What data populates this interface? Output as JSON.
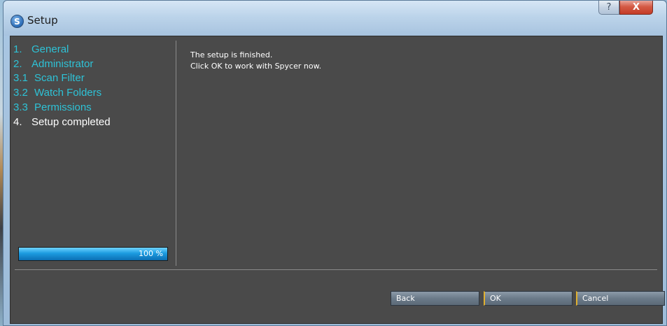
{
  "window": {
    "title": "Setup",
    "app_icon_glyph": "S",
    "help_glyph": "?",
    "close_glyph": "X"
  },
  "nav": {
    "items": [
      {
        "num": "1.",
        "label": "General",
        "state": "done"
      },
      {
        "num": "2.",
        "label": "Administrator",
        "state": "done"
      },
      {
        "num": "3.1",
        "label": "Scan Filter",
        "state": "done"
      },
      {
        "num": "3.2",
        "label": "Watch Folders",
        "state": "done"
      },
      {
        "num": "3.3",
        "label": "Permissions",
        "state": "done"
      },
      {
        "num": "4.",
        "label": "Setup completed",
        "state": "current"
      }
    ]
  },
  "progress": {
    "value": 100,
    "label": "100 %"
  },
  "message": {
    "line1": "The setup is finished.",
    "line2": "Click OK to work with Spycer now."
  },
  "buttons": {
    "back": "Back",
    "ok": "OK",
    "cancel": "Cancel"
  },
  "colors": {
    "link": "#2ec2d6",
    "current": "#ffffff",
    "panel": "#4a4a4a",
    "progress": "#1c9be0",
    "default_button_accent": "#e0b030"
  }
}
